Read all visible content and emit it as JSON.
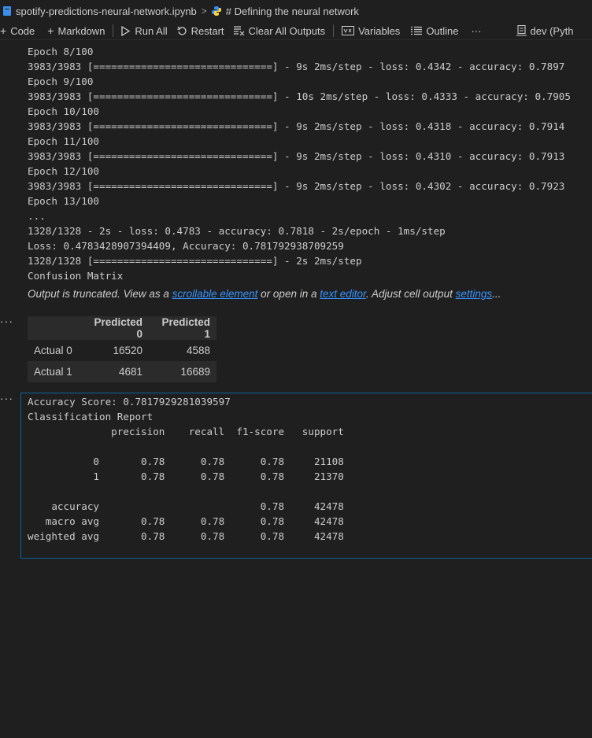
{
  "breadcrumb": {
    "file": "spotify-predictions-neural-network.ipynb",
    "cell": "# Defining the neural network"
  },
  "toolbar": {
    "code": "Code",
    "markdown": "Markdown",
    "run_all": "Run All",
    "restart": "Restart",
    "clear_outputs": "Clear All Outputs",
    "variables": "Variables",
    "outline": "Outline",
    "more": "···",
    "kernel": "dev (Pyth"
  },
  "output_training": [
    "Epoch 8/100",
    "3983/3983 [==============================] - 9s 2ms/step - loss: 0.4342 - accuracy: 0.7897",
    "Epoch 9/100",
    "3983/3983 [==============================] - 10s 2ms/step - loss: 0.4333 - accuracy: 0.7905",
    "Epoch 10/100",
    "3983/3983 [==============================] - 9s 2ms/step - loss: 0.4318 - accuracy: 0.7914",
    "Epoch 11/100",
    "3983/3983 [==============================] - 9s 2ms/step - loss: 0.4310 - accuracy: 0.7913",
    "Epoch 12/100",
    "3983/3983 [==============================] - 9s 2ms/step - loss: 0.4302 - accuracy: 0.7923",
    "Epoch 13/100",
    "...",
    "1328/1328 - 2s - loss: 0.4783 - accuracy: 0.7818 - 2s/epoch - 1ms/step",
    "Loss: 0.4783428907394409, Accuracy: 0.781792938709259",
    "1328/1328 [==============================] - 2s 2ms/step",
    "Confusion Matrix"
  ],
  "truncation": {
    "prefix": "Output is truncated. View as a ",
    "link_scrollable": "scrollable element",
    "middle": " or open in a ",
    "link_editor": "text editor",
    "suffix_before_settings": ". Adjust cell output ",
    "link_settings": "settings",
    "end": "..."
  },
  "cell_more": "···",
  "confusion_matrix": {
    "columns": [
      "",
      "Predicted 0",
      "Predicted 1"
    ],
    "rows": [
      {
        "label": "Actual 0",
        "values": [
          "16520",
          "4588"
        ]
      },
      {
        "label": "Actual 1",
        "values": [
          "4681",
          "16689"
        ]
      }
    ]
  },
  "output_report": [
    "Accuracy Score: 0.7817929281039597",
    "Classification Report",
    "              precision    recall  f1-score   support",
    "",
    "           0       0.78      0.78      0.78     21108",
    "           1       0.78      0.78      0.78     21370",
    "",
    "    accuracy                           0.78     42478",
    "   macro avg       0.78      0.78      0.78     42478",
    "weighted avg       0.78      0.78      0.78     42478"
  ]
}
